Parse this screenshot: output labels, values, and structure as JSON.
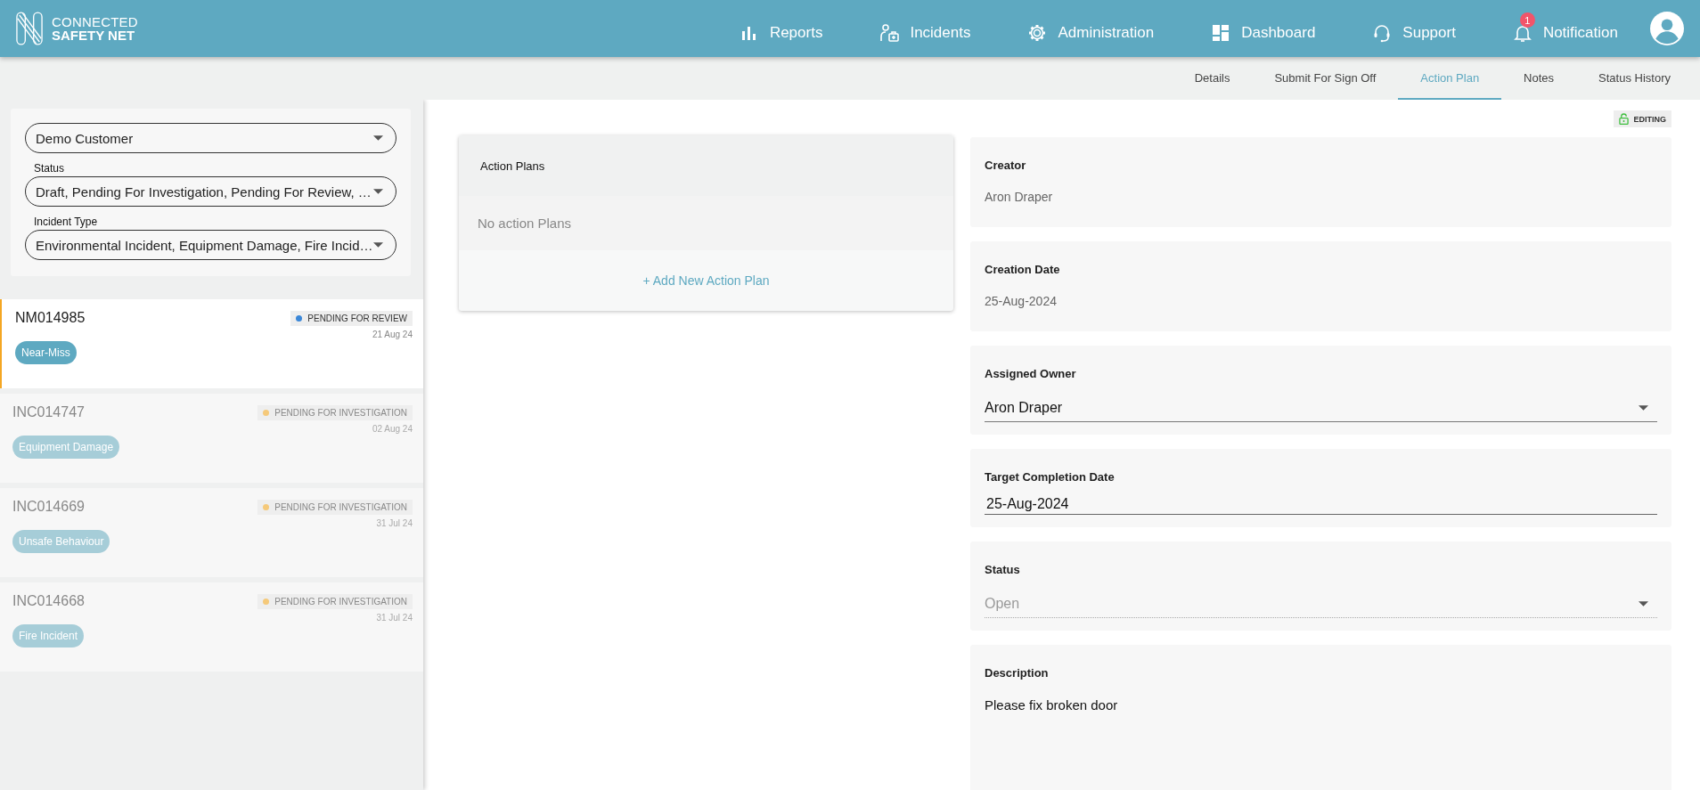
{
  "header": {
    "logo": {
      "line1": "CONNECTED",
      "line2": "SAFETY NET"
    },
    "nav": [
      {
        "label": "Reports"
      },
      {
        "label": "Incidents"
      },
      {
        "label": "Administration"
      },
      {
        "label": "Dashboard"
      },
      {
        "label": "Support"
      },
      {
        "label": "Notification",
        "badge": "1"
      }
    ]
  },
  "tabs": [
    {
      "label": "Details",
      "selected": false
    },
    {
      "label": "Submit For Sign Off",
      "selected": false
    },
    {
      "label": "Action Plan",
      "selected": true
    },
    {
      "label": "Notes",
      "selected": false
    },
    {
      "label": "Status History",
      "selected": false
    }
  ],
  "filters": [
    {
      "value": "Demo Customer"
    },
    {
      "label": "Status",
      "value": "Draft, Pending For Investigation, Pending For Review, …"
    },
    {
      "label": "Incident Type",
      "value": "Environmental Incident, Equipment Damage, Fire Incid…"
    }
  ],
  "incidents": [
    {
      "id": "NM014985",
      "status": "PENDING FOR REVIEW",
      "color": "#3b87d8",
      "date": "21 Aug 24",
      "tag": "Near-Miss",
      "selected": true
    },
    {
      "id": "INC014747",
      "status": "PENDING FOR INVESTIGATION",
      "color": "#f5c97a",
      "date": "02 Aug 24",
      "tag": "Equipment Damage",
      "selected": false
    },
    {
      "id": "INC014669",
      "status": "PENDING FOR INVESTIGATION",
      "color": "#f5c97a",
      "date": "31 Jul 24",
      "tag": "Unsafe Behaviour",
      "selected": false
    },
    {
      "id": "INC014668",
      "status": "PENDING FOR INVESTIGATION",
      "color": "#f5c97a",
      "date": "31 Jul 24",
      "tag": "Fire Incident",
      "selected": false
    }
  ],
  "action_plans": {
    "title": "Action Plans",
    "empty": "No action Plans",
    "add": "+ Add New Action Plan"
  },
  "lock_badge": {
    "label": "EDITING"
  },
  "fields": [
    {
      "kind": "text",
      "label": "Creator",
      "value": "Aron Draper"
    },
    {
      "kind": "text",
      "label": "Creation Date",
      "value": "25-Aug-2024"
    },
    {
      "kind": "select",
      "label": "Assigned Owner",
      "value": "Aron Draper",
      "disabled": false
    },
    {
      "kind": "date",
      "label": "Target Completion Date",
      "value": "25-Aug-2024"
    },
    {
      "kind": "select",
      "label": "Status",
      "value": "Open",
      "disabled": true
    },
    {
      "kind": "textarea",
      "label": "Description",
      "value": "Please fix broken door"
    }
  ]
}
